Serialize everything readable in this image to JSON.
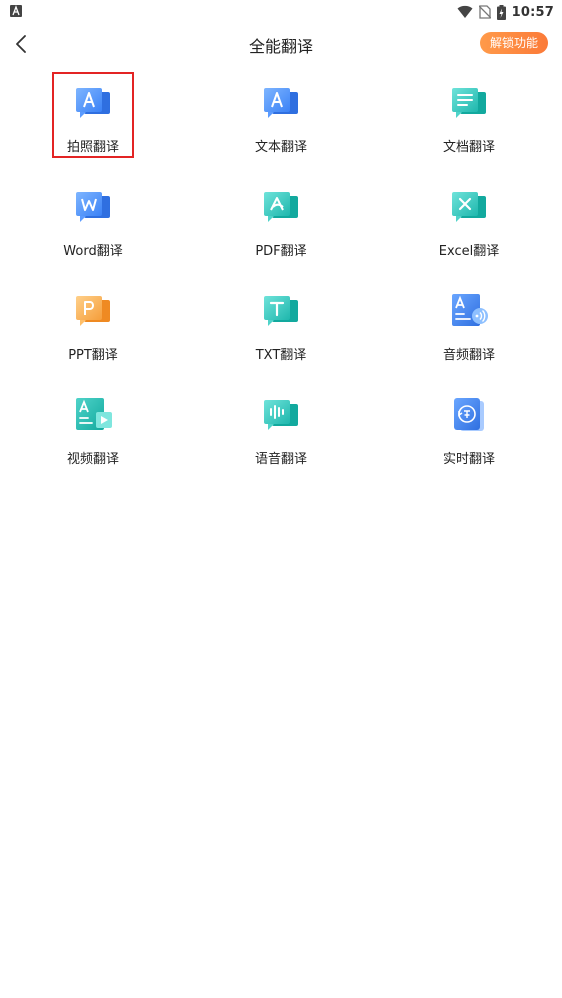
{
  "status_bar": {
    "time": "10:57"
  },
  "header": {
    "title": "全能翻译",
    "unlock_label": "解锁功能"
  },
  "features": [
    {
      "label": "拍照翻译",
      "icon": "photo-translate-icon"
    },
    {
      "label": "文本翻译",
      "icon": "text-translate-icon"
    },
    {
      "label": "文档翻译",
      "icon": "document-translate-icon"
    },
    {
      "label": "Word翻译",
      "icon": "word-translate-icon"
    },
    {
      "label": "PDF翻译",
      "icon": "pdf-translate-icon"
    },
    {
      "label": "Excel翻译",
      "icon": "excel-translate-icon"
    },
    {
      "label": "PPT翻译",
      "icon": "ppt-translate-icon"
    },
    {
      "label": "TXT翻译",
      "icon": "txt-translate-icon"
    },
    {
      "label": "音频翻译",
      "icon": "audio-translate-icon"
    },
    {
      "label": "视频翻译",
      "icon": "video-translate-icon"
    },
    {
      "label": "语音翻译",
      "icon": "voice-translate-icon"
    },
    {
      "label": "实时翻译",
      "icon": "realtime-translate-icon"
    }
  ],
  "colors": {
    "blue": "#3b82f6",
    "teal": "#22c1b8",
    "orange": "#f59e3b",
    "accent": "#fb7a38",
    "highlight_border": "#e32424"
  }
}
